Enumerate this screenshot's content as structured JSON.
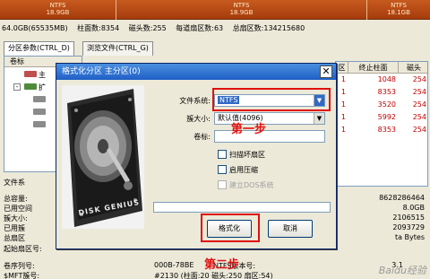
{
  "disk_strip": {
    "segments": [
      {
        "fs": "NTFS",
        "size": "18.9GB"
      },
      {
        "fs": "NTFS",
        "size": "18.9GB"
      },
      {
        "fs": "NTFS",
        "size": "18.1GB"
      }
    ]
  },
  "info_line": {
    "capacity": "64.0GB(65535MB)",
    "cylinders": "柱面数:8354",
    "heads": "磁头数:255",
    "sectors_per_track": "每道扇区数:63",
    "total_sectors": "总扇区数:134215680"
  },
  "tabs": [
    {
      "label": "分区参数(CTRL_D)"
    },
    {
      "label": "浏览文件(CTRL_G)"
    }
  ],
  "tree": {
    "header": "卷标",
    "rows": [
      {
        "box": "",
        "label": "主"
      },
      {
        "box": "-",
        "label": "扩"
      },
      {
        "box": "",
        "label": ""
      },
      {
        "box": "",
        "label": ""
      },
      {
        "box": "",
        "label": ""
      }
    ]
  },
  "partition_table": {
    "headers": [
      "区",
      "终止柱面",
      "磁头"
    ],
    "rows": [
      {
        "c1": "1",
        "c2": "1048",
        "c3": "254"
      },
      {
        "c1": "1",
        "c2": "8353",
        "c3": "254"
      },
      {
        "c1": "1",
        "c2": "3520",
        "c3": "254"
      },
      {
        "c1": "1",
        "c2": "5992",
        "c3": "254"
      },
      {
        "c1": "1",
        "c2": "8353",
        "c3": "254"
      }
    ]
  },
  "bottom_left": {
    "fs_label": "文件系",
    "total_capacity": "总容量:",
    "used_space": "已用空间",
    "cluster_size": "簇大小:",
    "used_clusters": "已用簇",
    "total_sectors": "总扇区",
    "start_sector": "起始扇区号:",
    "volume_serial": "卷序列号:",
    "mft_number": "$MFT簇号:"
  },
  "bottom_values": {
    "v1": "8628286464",
    "v2": "8.0GB",
    "v3": "2106515",
    "v4": "2093729",
    "v5": "ta Bytes",
    "start_sector_value": "63",
    "volume_serial_value": "000B-78BE",
    "volume_serial_right": "NTFS版本号:",
    "volume_serial_version": "3.1",
    "mft_value": "#2130 (柱面:20 磁头:250 扇区:54)"
  },
  "dialog": {
    "title": "格式化分区 主分区(0)",
    "close_glyph": "✕",
    "filesystem_label": "文件系统:",
    "filesystem_value": "NTFS",
    "cluster_label": "簇大小:",
    "cluster_value": "默认值(4096)",
    "volume_label": "卷标:",
    "volume_value": "",
    "check_scan": "扫描坏扇区",
    "check_compress": "启用压缩",
    "check_dos": "建立DOS系统",
    "format_button": "格式化",
    "cancel_button": "取消",
    "drive_brand": "DISK GENIUS"
  },
  "annotations": {
    "step1": "第一步",
    "step2": "第二步"
  },
  "watermark": "Baidu经验",
  "colors": {
    "annotation_red": "#e01010",
    "title_blue": "#1f5fc6",
    "strip_orange": "#b84a14",
    "table_red_text": "#c00000"
  }
}
